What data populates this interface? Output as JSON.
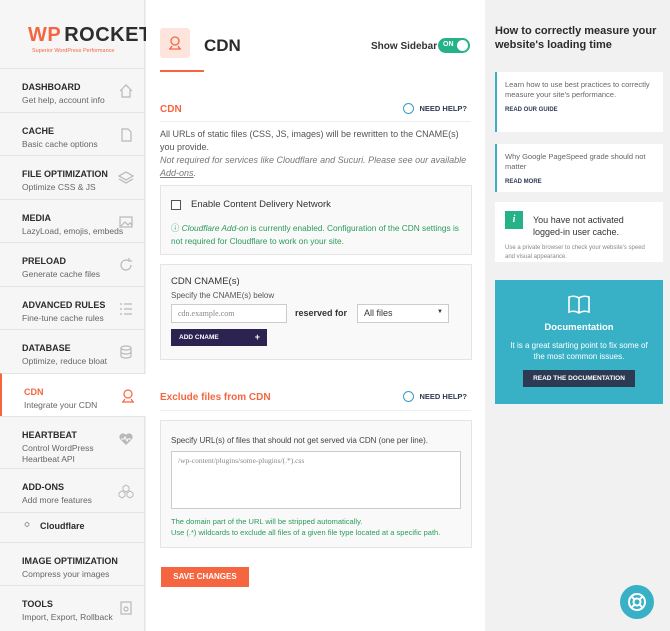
{
  "logo": {
    "brand_wp": "WP",
    "brand_name": "ROCKET",
    "tagline": "Superior WordPress Performance"
  },
  "nav": [
    {
      "title": "DASHBOARD",
      "subtitle": "Get help, account info",
      "icon": "home-icon"
    },
    {
      "title": "CACHE",
      "subtitle": "Basic cache options",
      "icon": "file-icon"
    },
    {
      "title": "FILE OPTIMIZATION",
      "subtitle": "Optimize CSS & JS",
      "icon": "layers-icon"
    },
    {
      "title": "MEDIA",
      "subtitle": "LazyLoad, emojis, embeds",
      "icon": "image-icon"
    },
    {
      "title": "PRELOAD",
      "subtitle": "Generate cache files",
      "icon": "refresh-icon"
    },
    {
      "title": "ADVANCED RULES",
      "subtitle": "Fine-tune cache rules",
      "icon": "list-icon"
    },
    {
      "title": "DATABASE",
      "subtitle": "Optimize, reduce bloat",
      "icon": "database-icon"
    },
    {
      "title": "CDN",
      "subtitle": "Integrate your CDN",
      "icon": "cdn-icon"
    },
    {
      "title": "HEARTBEAT",
      "subtitle": "Control WordPress Heartbeat API",
      "icon": "heartbeat-icon"
    },
    {
      "title": "ADD-ONS",
      "subtitle": "Add more features",
      "icon": "cubes-icon"
    },
    {
      "title": "Cloudflare",
      "subtitle": "",
      "icon": "cloudflare-icon"
    },
    {
      "title": "IMAGE OPTIMIZATION",
      "subtitle": "Compress your images",
      "icon": ""
    },
    {
      "title": "TOOLS",
      "subtitle": "Import, Export, Rollback",
      "icon": "tools-icon"
    }
  ],
  "header": {
    "title": "CDN",
    "show_sidebar_label": "Show Sidebar",
    "toggle_label": "ON"
  },
  "cdn_section": {
    "title": "CDN",
    "help_label": "NEED HELP?",
    "description": "All URLs of static files (CSS, JS, images) will be rewritten to the CNAME(s) you provide.",
    "note_pre": "Not required for services like Cloudflare and Sucuri. Please see our available ",
    "note_link": "Add-ons",
    "note_post": ".",
    "enable_label": "Enable Content Delivery Network",
    "cf_note_em": "Cloudflare Add-on",
    "cf_note_rest": " is currently enabled. Configuration of the CDN settings is not required for Cloudflare to work on your site.",
    "cname_title": "CDN CNAME(s)",
    "cname_sub": "Specify the CNAME(s) below",
    "cname_placeholder": "cdn.example.com",
    "reserved_label": "reserved for",
    "reserved_value": "All files",
    "add_cname_label": "ADD CNAME"
  },
  "exclude_section": {
    "title": "Exclude files from CDN",
    "help_label": "NEED HELP?",
    "description": "Specify URL(s) of files that should not get served via CDN (one per line).",
    "placeholder": "/wp-content/plugins/some-plugins/(.*).css",
    "note1": "The domain part of the URL will be stripped automatically.",
    "note2": "Use (.*) wildcards to exclude all files of a given file type located at a specific path."
  },
  "save_label": "SAVE CHANGES",
  "right": {
    "title": "How to correctly measure your website's loading time",
    "card1_text": "Learn how to use best practices to correctly measure your site's performance.",
    "card1_link": "READ OUR GUIDE",
    "card2_text": "Why Google PageSpeed grade should not matter",
    "card2_link": "READ MORE",
    "cache_note": "You have not activated logged-in user cache.",
    "cache_note_sub": "Use a private browser to check your website's speed and visual appearance.",
    "doc_title": "Documentation",
    "doc_desc": "It is a great starting point to fix some of the most common issues.",
    "doc_button": "READ THE DOCUMENTATION"
  },
  "colors": {
    "accent": "#f56640",
    "teal": "#38b1c6",
    "green": "#25b288",
    "navy": "#2c2351"
  }
}
